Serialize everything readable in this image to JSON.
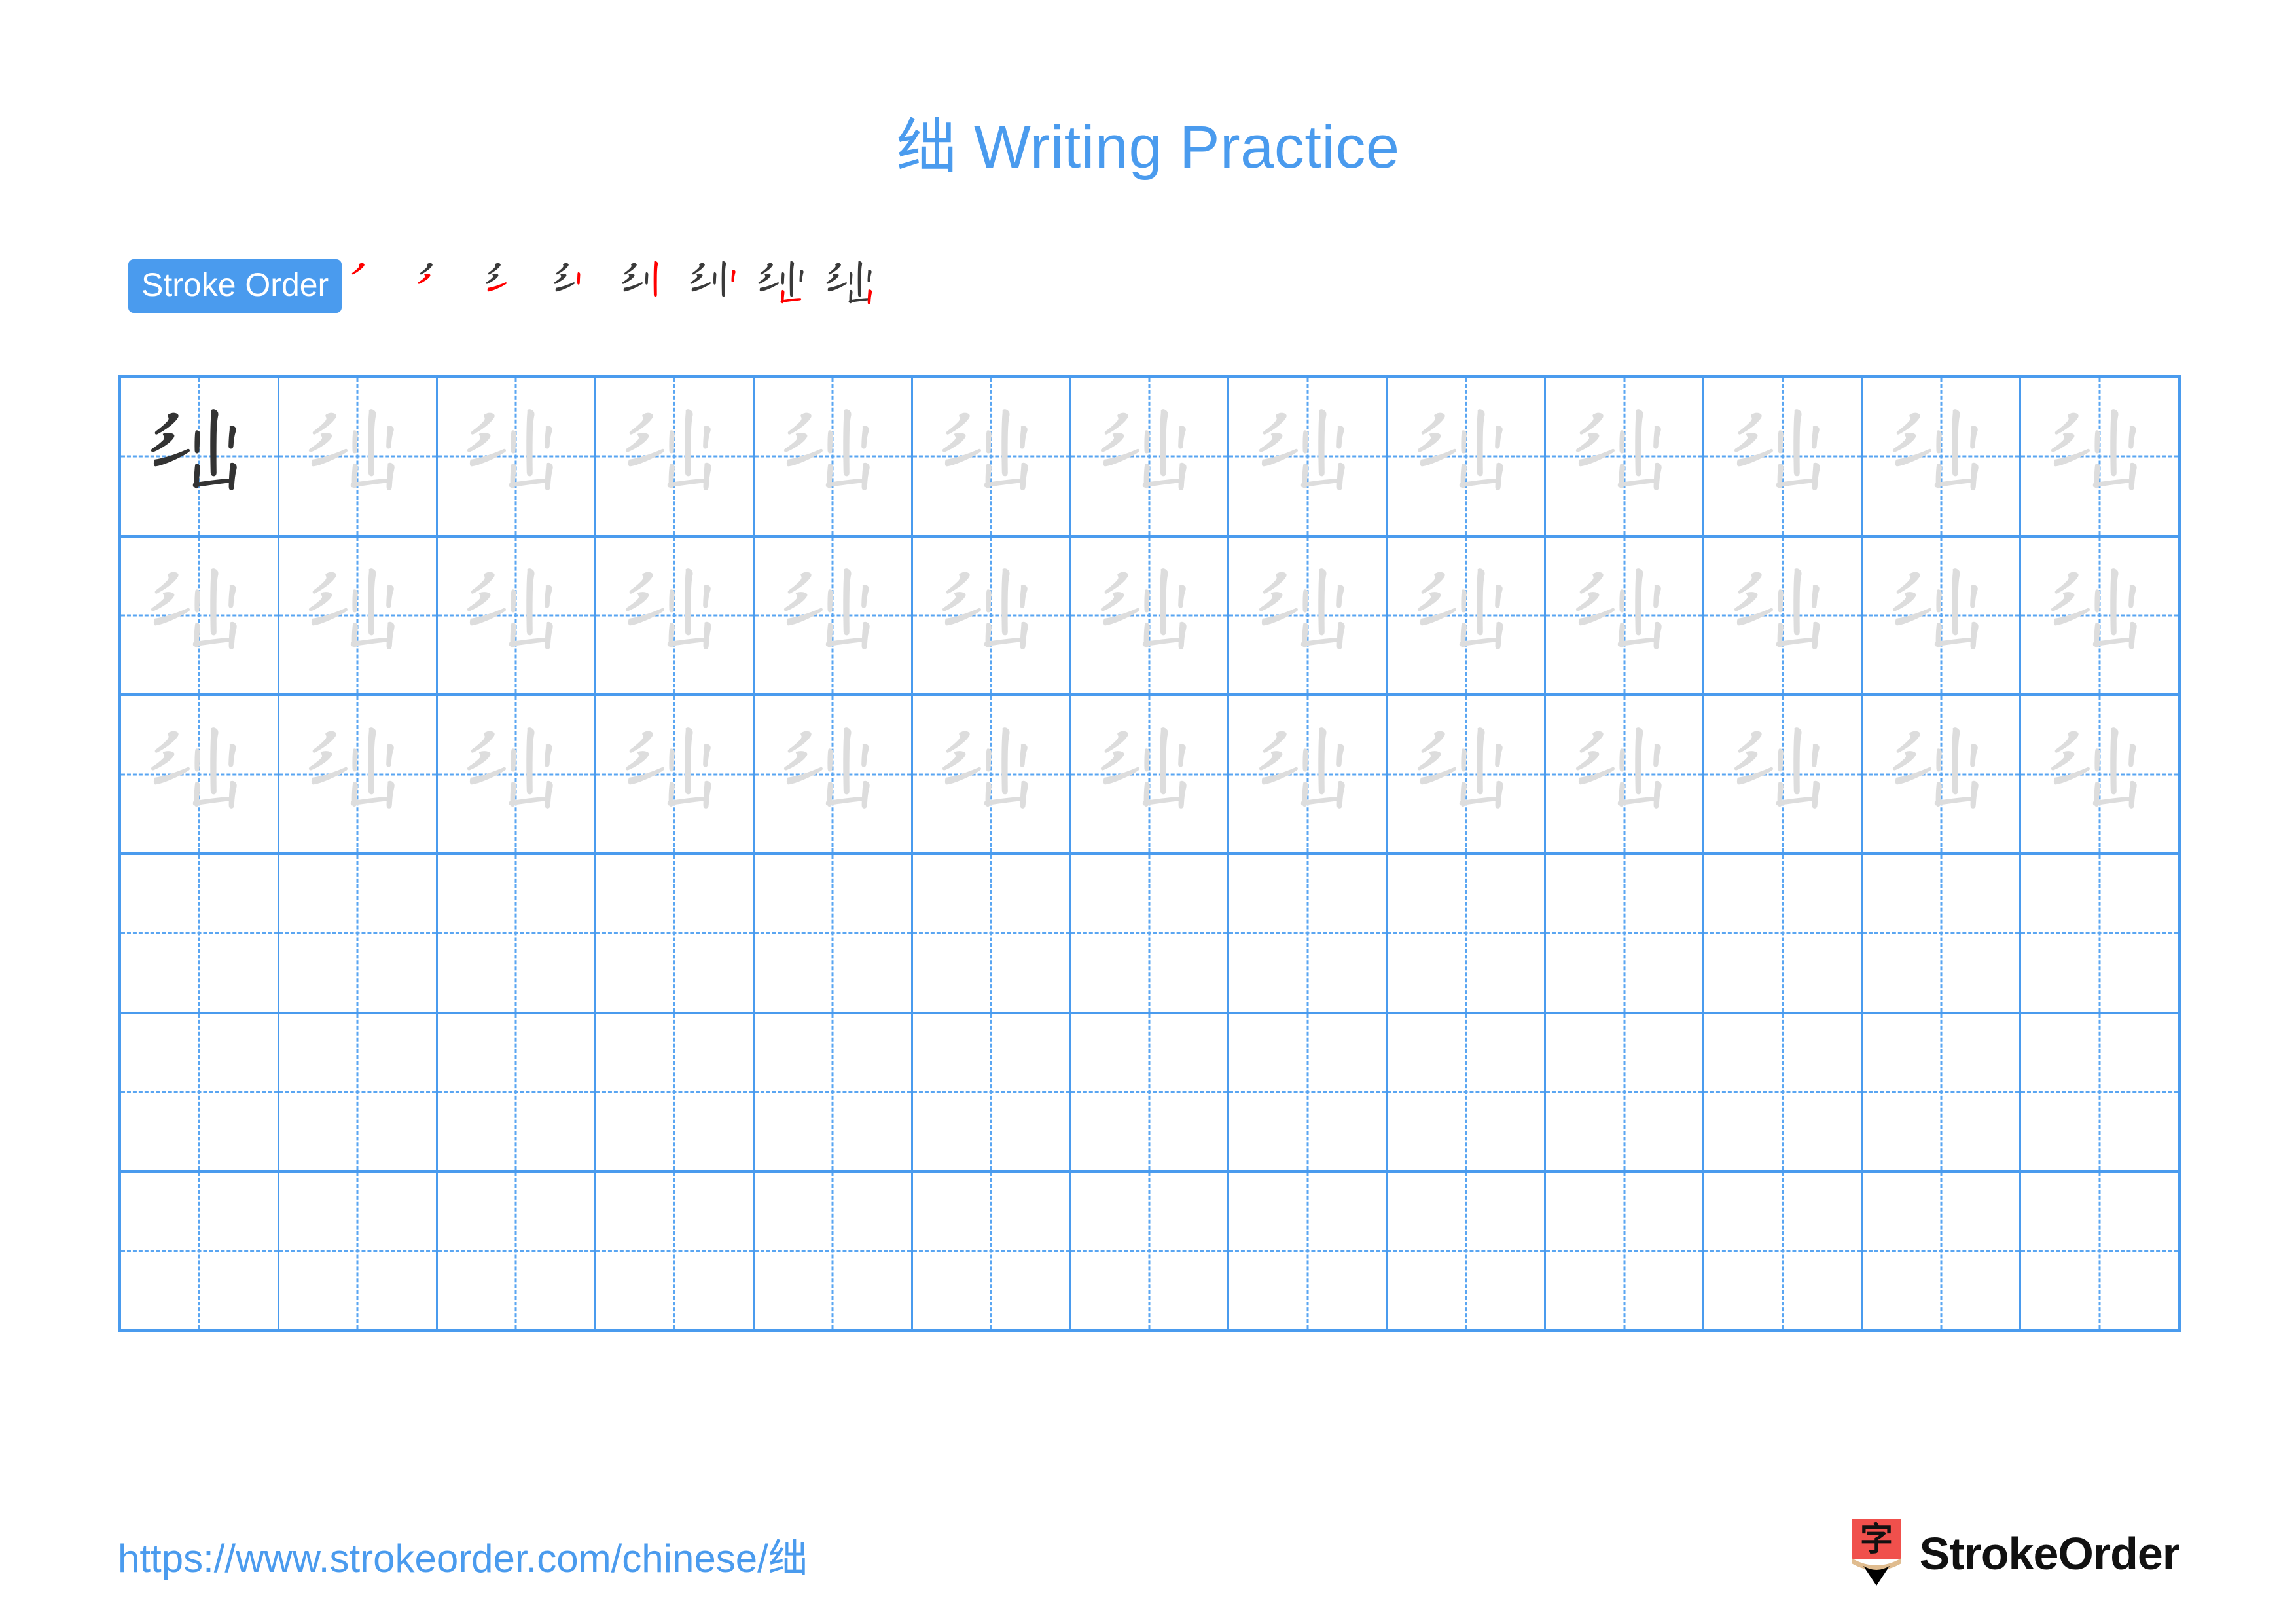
{
  "character": "绌",
  "title": {
    "character": "绌",
    "suffix": " Writing Practice",
    "full": "绌 Writing Practice",
    "color": "#4a9bee"
  },
  "stroke_order": {
    "badge_label": "Stroke Order",
    "badge_bg": "#4a9bee",
    "badge_text_color": "#ffffff",
    "stroke_count": 8,
    "done_color": "#3a3a3a",
    "new_color": "#ff0000",
    "steps": [
      {
        "index": 1,
        "strokes_shown": 1,
        "new_stroke": 1
      },
      {
        "index": 2,
        "strokes_shown": 2,
        "new_stroke": 2
      },
      {
        "index": 3,
        "strokes_shown": 3,
        "new_stroke": 3
      },
      {
        "index": 4,
        "strokes_shown": 4,
        "new_stroke": 4
      },
      {
        "index": 5,
        "strokes_shown": 5,
        "new_stroke": 5
      },
      {
        "index": 6,
        "strokes_shown": 6,
        "new_stroke": 6
      },
      {
        "index": 7,
        "strokes_shown": 7,
        "new_stroke": 7
      },
      {
        "index": 8,
        "strokes_shown": 8,
        "new_stroke": 8
      }
    ]
  },
  "grid": {
    "columns": 13,
    "rows": 6,
    "filled_rows": 3,
    "empty_rows": 3,
    "line_color": "#4a9bee",
    "guide_color": "#5aa6f2",
    "dark_glyph_color": "#333333",
    "light_glyph_color": "#dddddd",
    "first_cell_is_dark": true
  },
  "footer": {
    "url": "https://www.strokeorder.com/chinese/绌",
    "url_color": "#4a9bee",
    "brand_name": "StrokeOrder",
    "brand_mark_char": "字",
    "brand_mark_color": "#f0504c",
    "brand_mark_wood_color": "#e0bc8f",
    "brand_mark_tip_color": "#000000"
  }
}
